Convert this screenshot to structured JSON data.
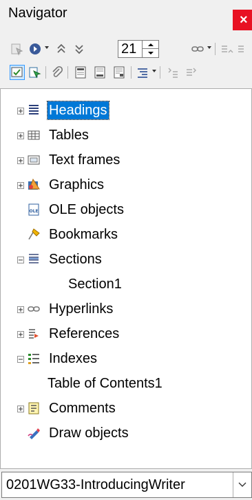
{
  "window": {
    "title": "Navigator",
    "close_glyph": "×"
  },
  "toolbar_row1": {
    "icons": [
      "toggle-icon",
      "navigate-by-icon",
      "previous-icon",
      "next-icon",
      "insert-hyperlink-icon",
      "promote-level-icon"
    ],
    "page_number": "21"
  },
  "toolbar_row2": {
    "icons": [
      "content-view-icon",
      "set-reminder-icon",
      "attachment-icon",
      "header-icon",
      "footer-icon",
      "anchor-icon",
      "heading-levels-icon",
      "promote-chapter-icon",
      "demote-chapter-icon"
    ]
  },
  "tree": {
    "items": [
      {
        "label": "Headings",
        "expander": "plus",
        "icon": "headings-icon",
        "selected": true
      },
      {
        "label": "Tables",
        "expander": "plus",
        "icon": "tables-icon"
      },
      {
        "label": "Text frames",
        "expander": "plus",
        "icon": "text-frames-icon"
      },
      {
        "label": "Graphics",
        "expander": "plus",
        "icon": "graphics-icon"
      },
      {
        "label": "OLE objects",
        "expander": "none",
        "icon": "ole-icon"
      },
      {
        "label": "Bookmarks",
        "expander": "none",
        "icon": "bookmark-icon"
      },
      {
        "label": "Sections",
        "expander": "minus",
        "icon": "sections-icon"
      },
      {
        "label": "Section1",
        "child": true
      },
      {
        "label": "Hyperlinks",
        "expander": "plus",
        "icon": "hyperlinks-icon"
      },
      {
        "label": "References",
        "expander": "plus",
        "icon": "references-icon"
      },
      {
        "label": "Indexes",
        "expander": "minus",
        "icon": "indexes-icon"
      },
      {
        "label": "Table of Contents1",
        "child": true
      },
      {
        "label": "Comments",
        "expander": "plus",
        "icon": "comments-icon"
      },
      {
        "label": "Draw objects",
        "expander": "none",
        "icon": "draw-objects-icon"
      }
    ]
  },
  "document_selector": {
    "value": "0201WG33-IntroducingWriter"
  },
  "colors": {
    "accent": "#0078d7",
    "close": "#e81123",
    "panel": "#f0f0f0"
  }
}
